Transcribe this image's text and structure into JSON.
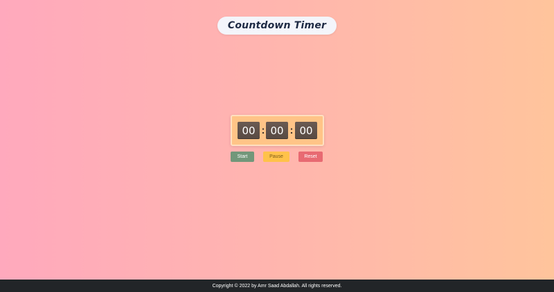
{
  "header": {
    "title": "Countdown Timer"
  },
  "timer": {
    "hours": "00",
    "minutes": "00",
    "seconds": "00",
    "separator": ":"
  },
  "controls": {
    "start_label": "Start",
    "pause_label": "Pause",
    "reset_label": "Reset"
  },
  "footer": {
    "copyright": "Copyright © 2022 by Amr Saad Abdallah. All rights reserved."
  },
  "colors": {
    "background_start": "#ffa9bd",
    "background_end": "#ffc49c",
    "timer_panel": "#ffc487",
    "digit_tile": "#5e4f48",
    "start_button": "#72977a",
    "pause_button": "#ffc24a",
    "reset_button": "#e86a72",
    "footer": "#222528"
  }
}
